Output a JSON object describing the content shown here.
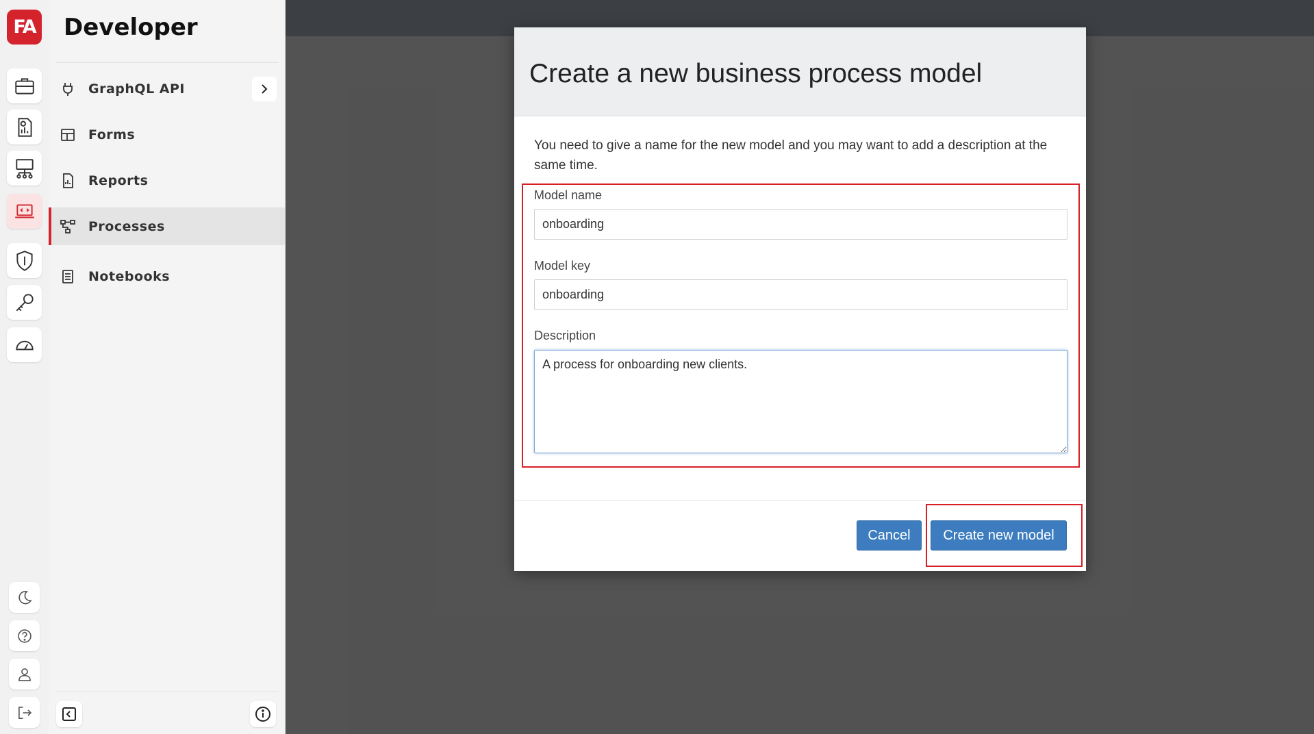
{
  "rail": {
    "logo_text": "FA",
    "items": [
      {
        "icon": "briefcase-icon"
      },
      {
        "icon": "analytics-report-icon"
      },
      {
        "icon": "network-diagram-icon"
      },
      {
        "icon": "developer-laptop-icon",
        "active": true
      },
      {
        "icon": "shield-icon"
      },
      {
        "icon": "key-icon"
      },
      {
        "icon": "speedometer-icon"
      }
    ],
    "bottom_items": [
      {
        "icon": "moon-icon"
      },
      {
        "icon": "help-icon"
      },
      {
        "icon": "user-icon"
      },
      {
        "icon": "logout-icon"
      }
    ]
  },
  "panel": {
    "title": "Developer",
    "items": [
      {
        "label": "GraphQL API",
        "icon": "plug-icon",
        "has_chevron": true
      },
      {
        "label": "Forms",
        "icon": "grid-icon"
      },
      {
        "label": "Reports",
        "icon": "report-icon"
      },
      {
        "label": "Processes",
        "icon": "process-flow-icon",
        "active": true
      },
      {
        "label": "Notebooks",
        "icon": "notebook-icon"
      }
    ],
    "footer": {
      "left_icon": "collapse-icon",
      "right_icon": "info-icon"
    }
  },
  "modal": {
    "title": "Create a new business process model",
    "intro": "You need to give a name for the new model and you may want to add a description at the same time.",
    "fields": {
      "name_label": "Model name",
      "name_value": "onboarding",
      "key_label": "Model key",
      "key_value": "onboarding",
      "description_label": "Description",
      "description_value": "A process for onboarding new clients."
    },
    "cancel_label": "Cancel",
    "create_label": "Create new model"
  },
  "colors": {
    "brand_red": "#d4232c",
    "highlight_red": "#d71f28",
    "button_blue": "#3d7dbf"
  }
}
